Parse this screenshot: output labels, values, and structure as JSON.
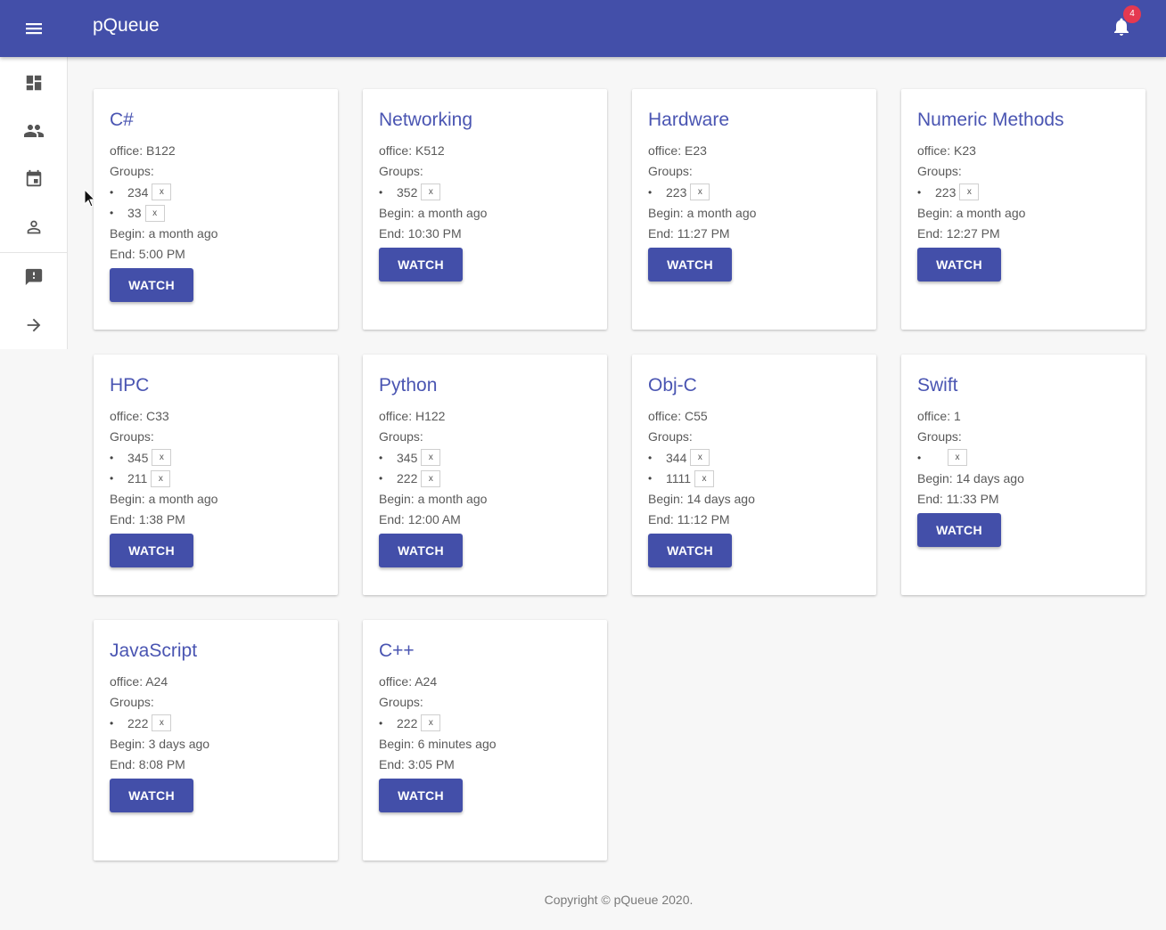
{
  "app": {
    "title": "pQueue",
    "notifications_count": "4"
  },
  "sidebar": {
    "items": [
      {
        "icon": "dashboard-icon"
      },
      {
        "icon": "people-icon"
      },
      {
        "icon": "calendar-icon"
      },
      {
        "icon": "person-icon"
      },
      {
        "icon": "feedback-icon"
      },
      {
        "icon": "arrow-right-icon"
      }
    ]
  },
  "courses": [
    {
      "title": "C#",
      "office": "office: B122",
      "groups_label": "Groups:",
      "groups": [
        {
          "num": "234",
          "x": "x"
        },
        {
          "num": "33",
          "x": "x"
        }
      ],
      "begin": "Begin: a month ago",
      "end": "End: 5:00 PM",
      "button": "WATCH"
    },
    {
      "title": "Networking",
      "office": "office: K512",
      "groups_label": "Groups:",
      "groups": [
        {
          "num": "352",
          "x": "x"
        }
      ],
      "begin": "Begin: a month ago",
      "end": "End: 10:30 PM",
      "button": "WATCH"
    },
    {
      "title": "Hardware",
      "office": "office: E23",
      "groups_label": "Groups:",
      "groups": [
        {
          "num": "223",
          "x": "x"
        }
      ],
      "begin": "Begin: a month ago",
      "end": "End: 11:27 PM",
      "button": "WATCH"
    },
    {
      "title": "Numeric Methods",
      "office": "office: K23",
      "groups_label": "Groups:",
      "groups": [
        {
          "num": "223",
          "x": "x"
        }
      ],
      "begin": "Begin: a month ago",
      "end": "End: 12:27 PM",
      "button": "WATCH"
    },
    {
      "title": "HPC",
      "office": "office: C33",
      "groups_label": "Groups:",
      "groups": [
        {
          "num": "345",
          "x": "x"
        },
        {
          "num": "211",
          "x": "x"
        }
      ],
      "begin": "Begin: a month ago",
      "end": "End: 1:38 PM",
      "button": "WATCH"
    },
    {
      "title": "Python",
      "office": "office: H122",
      "groups_label": "Groups:",
      "groups": [
        {
          "num": "345",
          "x": "x"
        },
        {
          "num": "222",
          "x": "x"
        }
      ],
      "begin": "Begin: a month ago",
      "end": "End: 12:00 AM",
      "button": "WATCH"
    },
    {
      "title": "Obj-C",
      "office": "office: C55",
      "groups_label": "Groups:",
      "groups": [
        {
          "num": "344",
          "x": "x"
        },
        {
          "num": "1111",
          "x": "x"
        }
      ],
      "begin": "Begin: 14 days ago",
      "end": "End: 11:12 PM",
      "button": "WATCH"
    },
    {
      "title": "Swift",
      "office": "office: 1",
      "groups_label": "Groups:",
      "groups": [
        {
          "num": "",
          "x": "x"
        }
      ],
      "begin": "Begin: 14 days ago",
      "end": "End: 11:33 PM",
      "button": "WATCH"
    },
    {
      "title": "JavaScript",
      "office": "office: A24",
      "groups_label": "Groups:",
      "groups": [
        {
          "num": "222",
          "x": "x"
        }
      ],
      "begin": "Begin: 3 days ago",
      "end": "End: 8:08 PM",
      "button": "WATCH"
    },
    {
      "title": "C++",
      "office": "office: A24",
      "groups_label": "Groups:",
      "groups": [
        {
          "num": "222",
          "x": "x"
        }
      ],
      "begin": "Begin: 6 minutes ago",
      "end": "End: 3:05 PM",
      "button": "WATCH"
    }
  ],
  "footer": {
    "copyright": "Copyright © pQueue 2020."
  }
}
